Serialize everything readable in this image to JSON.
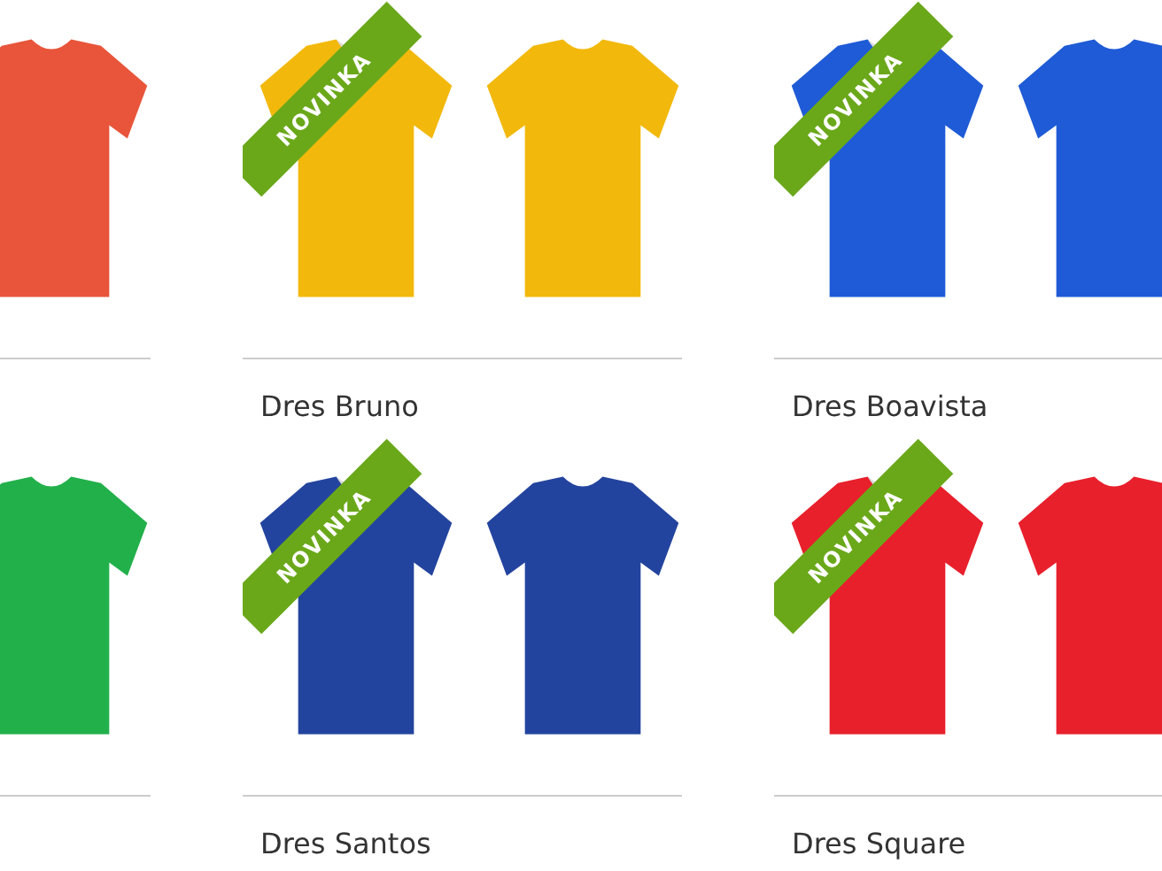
{
  "products": [
    {
      "color": "#e8553a"
    },
    {
      "color": "#f2b90c",
      "badge": "NOVINKA",
      "title": "Dres Bruno"
    },
    {
      "color": "#1f5bd6",
      "badge": "NOVINKA",
      "title": "Dres Boavista"
    },
    {
      "color": "#22b04b"
    },
    {
      "color": "#23449e",
      "badge": "NOVINKA",
      "title": "Dres Santos"
    },
    {
      "color": "#e8202c",
      "badge": "NOVINKA",
      "title": "Dres Square"
    }
  ]
}
